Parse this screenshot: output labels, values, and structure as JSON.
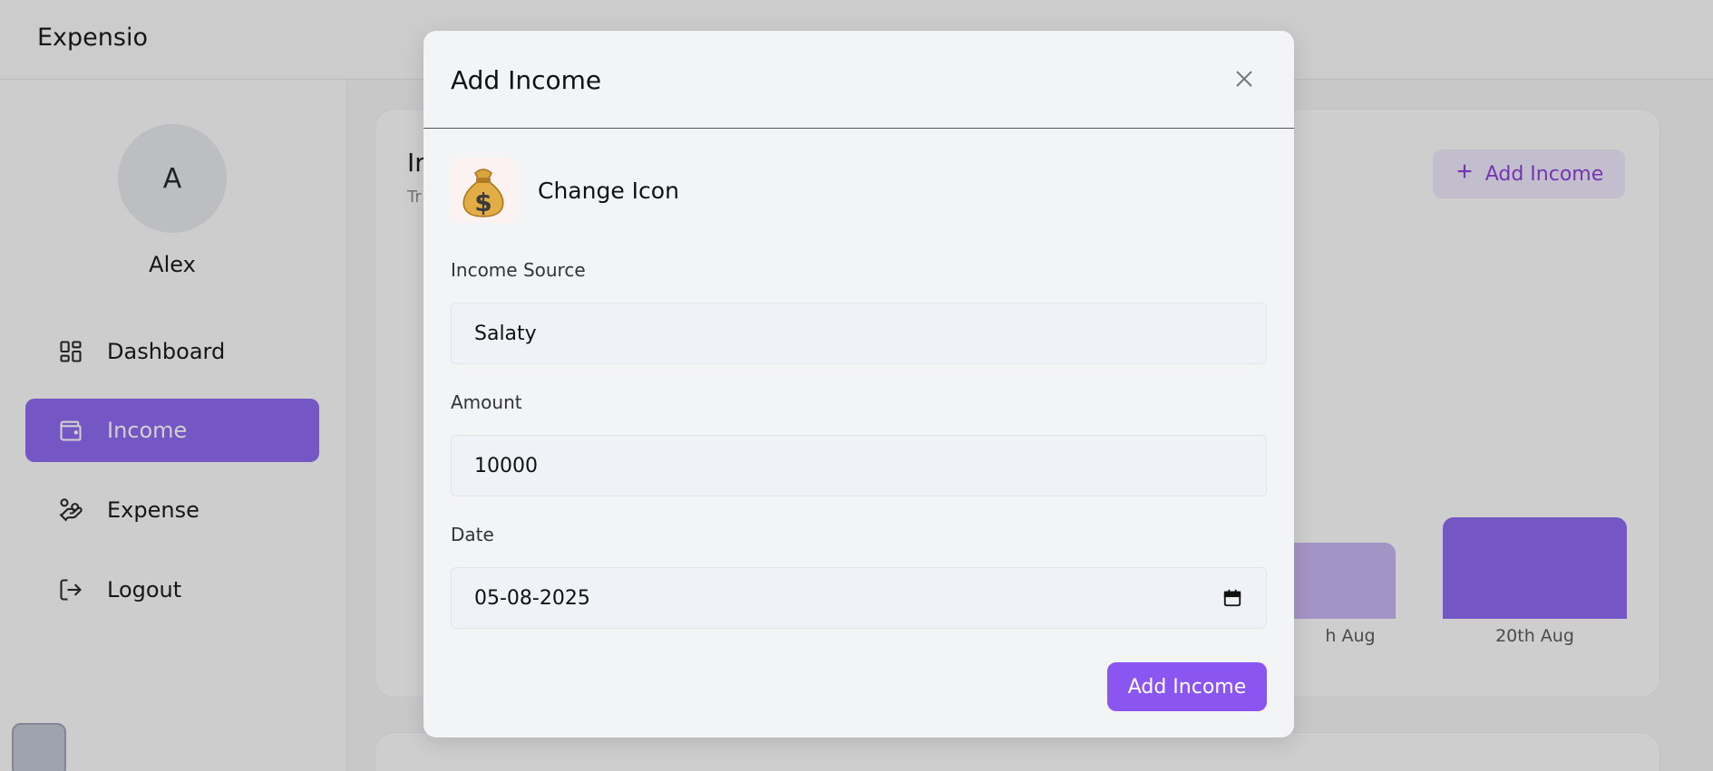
{
  "app": {
    "brand": "Expensio"
  },
  "sidebar": {
    "avatar_initial": "A",
    "username": "Alex",
    "items": [
      {
        "label": "Dashboard",
        "icon": "dashboard-grid-icon",
        "active": false
      },
      {
        "label": "Income",
        "icon": "wallet-icon",
        "active": true
      },
      {
        "label": "Expense",
        "icon": "hand-coins-icon",
        "active": false
      },
      {
        "label": "Logout",
        "icon": "logout-icon",
        "active": false
      }
    ]
  },
  "background_card": {
    "title_fragment": "In",
    "subtitle_fragment": "Tr",
    "add_button_label": "Add Income",
    "bars": [
      {
        "label": "h Aug",
        "color": "#c7b3f3"
      },
      {
        "label": "20th Aug",
        "color": "#8a63f0"
      }
    ]
  },
  "modal": {
    "title": "Add Income",
    "icon_emoji": "💰",
    "change_icon_label": "Change Icon",
    "fields": {
      "source": {
        "label": "Income Source",
        "value": "Salaty"
      },
      "amount": {
        "label": "Amount",
        "value": "10000"
      },
      "date": {
        "label": "Date",
        "value": "05-08-2025"
      }
    },
    "submit_label": "Add Income"
  },
  "colors": {
    "accent": "#8a55f0",
    "active_nav": "#8a63f0",
    "overlay": "rgba(40,40,40,0.22)"
  }
}
